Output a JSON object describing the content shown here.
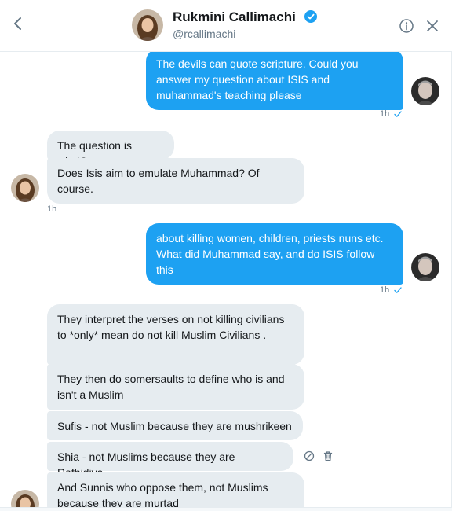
{
  "header": {
    "name": "Rukmini Callimachi",
    "handle": "@rcallimachi"
  },
  "colors": {
    "accent": "#1da1f2",
    "incoming_bubble": "#e6ecf0",
    "secondary_text": "#657786"
  },
  "icons": {
    "back": "chevron-left-icon",
    "verified": "verified-badge-icon",
    "info": "info-icon",
    "close": "close-icon",
    "read_receipt": "checkmark-icon",
    "report": "report-icon",
    "delete": "trash-icon"
  },
  "messages": [
    {
      "direction": "outgoing",
      "text": "The devils can quote scripture. Could you answer my question about ISIS and muhammad's teaching please",
      "time": "1h"
    },
    {
      "direction": "incoming",
      "text": "The question is what?"
    },
    {
      "direction": "incoming",
      "text": "Does Isis aim to emulate Muhammad? Of course.",
      "time": "1h"
    },
    {
      "direction": "outgoing",
      "text": "about killing women, children, priests nuns etc. What did Muhammad say, and do ISIS follow this",
      "time": "1h"
    },
    {
      "direction": "incoming",
      "text": "They interpret the verses on not killing civilians to *only* mean do not kill Muslim Civilians ."
    },
    {
      "direction": "incoming",
      "text": "They then do somersaults to define who is and isn't a Muslim"
    },
    {
      "direction": "incoming",
      "text": "Sufis - not Muslim because they are mushrikeen"
    },
    {
      "direction": "incoming",
      "text": "Shia - not Muslims because they are Rafhidiya"
    },
    {
      "direction": "incoming",
      "text": "And Sunnis who oppose them, not Muslims because they are murtad"
    }
  ]
}
